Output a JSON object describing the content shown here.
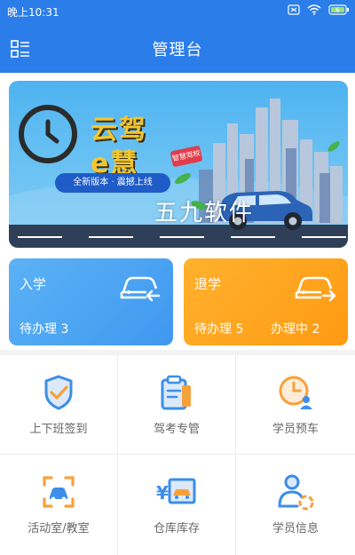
{
  "status_bar": {
    "time": "晚上10:31"
  },
  "header": {
    "title": "管理台",
    "menu_icon": "menu-grid-icon"
  },
  "banner": {
    "brand_line1": "云驾",
    "brand_line2": "e慧",
    "ribbon_text": "全新版本 · 震撼上线",
    "tag_text": "智慧驾校",
    "watermark": "五九软件"
  },
  "cards": {
    "enroll": {
      "title": "入学",
      "pending_text": "待办理 3",
      "color": "#4aa3f3",
      "icon": "car-enter-icon"
    },
    "withdraw": {
      "title": "退学",
      "pending_text": "待办理 5",
      "processing_text": "办理中 2",
      "color": "#ffa31f",
      "icon": "car-exit-icon"
    }
  },
  "menu": [
    {
      "label": "上下班签到",
      "icon": "shield-check-icon"
    },
    {
      "label": "驾考专管",
      "icon": "clipboard-icon"
    },
    {
      "label": "学员预车",
      "icon": "clock-user-icon"
    },
    {
      "label": "活动室/教室",
      "icon": "classroom-car-icon"
    },
    {
      "label": "仓库库存",
      "icon": "warehouse-icon"
    },
    {
      "label": "学员信息",
      "icon": "student-info-icon"
    }
  ],
  "colors": {
    "primary": "#2b7de9",
    "accent_orange": "#ff9a12",
    "icon_blue": "#3c8ee8",
    "icon_orange": "#f7a13a"
  }
}
